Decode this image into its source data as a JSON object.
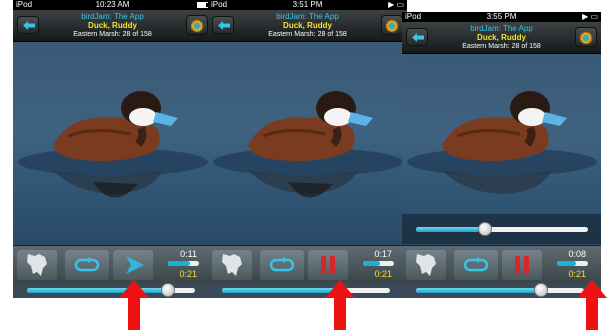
{
  "app": {
    "title": "birdJam: The App",
    "bird_name": "Duck, Ruddy",
    "playlist_line": "Eastern Marsh: 28 of 158"
  },
  "colors": {
    "title_cyan": "#38c3e8",
    "name_yellow": "#f3e233",
    "progress_blue": "#1ab1d6",
    "pointer_red": "#ee1111"
  },
  "screens": [
    {
      "carrier": "iPod",
      "time": "10:23 AM",
      "battery": "full",
      "play_state": "play",
      "total_time": "0:11",
      "current_time": "0:21",
      "time_progress": 0.7,
      "volume_level": 0.85,
      "icons": [
        "map-icon",
        "repeat-icon",
        "play-icon"
      ]
    },
    {
      "carrier": "iPod",
      "time": "3:51 PM",
      "battery": "play-indicator",
      "play_state": "pause",
      "total_time": "0:17",
      "current_time": "0:21",
      "time_progress": 0.55,
      "volume_level": 0.7,
      "icons": [
        "map-icon",
        "repeat-icon",
        "pause-icon"
      ]
    },
    {
      "carrier": "iPod",
      "time": "3:55 PM",
      "battery": "play-indicator",
      "play_state": "pause",
      "total_time": "0:08",
      "current_time": "0:21",
      "time_progress": 0.6,
      "volume_level": 0.75,
      "scrubber_level": 0.4,
      "icons": [
        "map-icon",
        "repeat-icon",
        "pause-icon"
      ]
    }
  ]
}
